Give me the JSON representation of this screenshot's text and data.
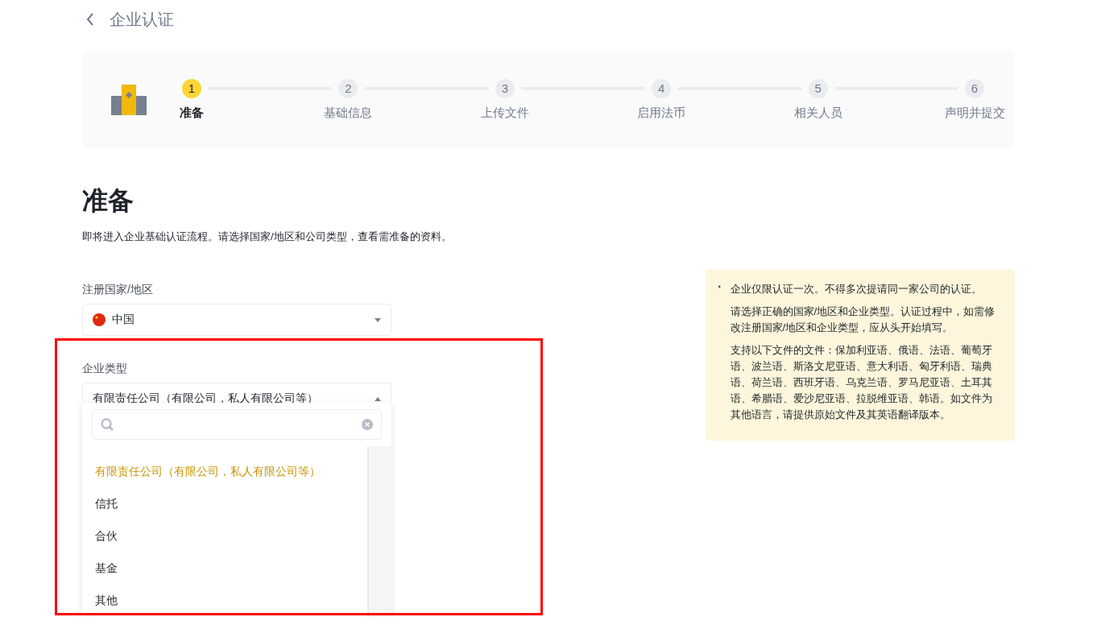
{
  "header": {
    "title": "企业认证"
  },
  "steps": [
    {
      "number": "1",
      "label": "准备",
      "selected": true
    },
    {
      "number": "2",
      "label": "基础信息",
      "selected": false
    },
    {
      "number": "3",
      "label": "上传文件",
      "selected": false
    },
    {
      "number": "4",
      "label": "启用法币",
      "selected": false
    },
    {
      "number": "5",
      "label": "相关人员",
      "selected": false
    },
    {
      "number": "6",
      "label": "声明并提交",
      "selected": false
    }
  ],
  "page": {
    "title": "准备",
    "description": "即将进入企业基础认证流程。请选择国家/地区和公司类型，查看需准备的资料。"
  },
  "country_field": {
    "label": "注册国家/地区",
    "value": "中国"
  },
  "type_field": {
    "label": "企业类型",
    "value": "有限责任公司（有限公司，私人有限公司等）",
    "expanded": true
  },
  "type_options": [
    {
      "label": "有限责任公司（有限公司，私人有限公司等）",
      "selected": true
    },
    {
      "label": "信托",
      "selected": false
    },
    {
      "label": "合伙",
      "selected": false
    },
    {
      "label": "基金",
      "selected": false
    },
    {
      "label": "其他",
      "selected": false
    }
  ],
  "tips": [
    "企业仅限认证一次。不得多次提请同一家公司的认证。",
    "请选择正确的国家/地区和企业类型。认证过程中，如需修改注册国家/地区和企业类型，应从头开始填写。",
    "支持以下文件的文件：保加利亚语、俄语、法语、葡萄牙语、波兰语、斯洛文尼亚语、意大利语、匈牙利语、瑞典语、荷兰语、西班牙语、乌克兰语、罗马尼亚语、土耳其语、希腊语、爱沙尼亚语、拉脱维亚语、韩语。如文件为其他语言，请提供原始文件及其英语翻译版本。"
  ]
}
